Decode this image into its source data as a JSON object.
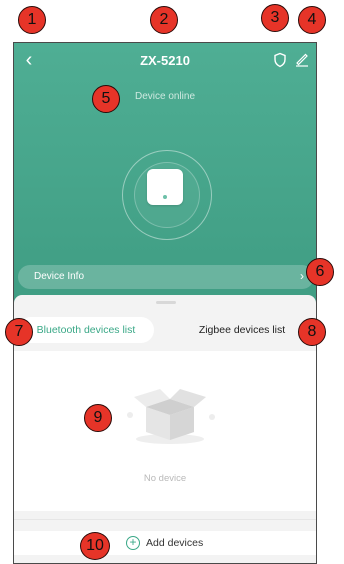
{
  "nav": {
    "title": "ZX-5210",
    "back_icon": "back-chevron-icon",
    "shield_icon": "shield-icon",
    "edit_icon": "pencil-icon"
  },
  "status": {
    "text": "Device online"
  },
  "device_info": {
    "label": "Device Info",
    "chevron": "›"
  },
  "tabs": [
    {
      "label": "Bluetooth devices list",
      "active": true
    },
    {
      "label": "Zigbee devices list",
      "active": false
    }
  ],
  "empty": {
    "text": "No device",
    "icon": "empty-box-icon"
  },
  "add": {
    "label": "Add devices",
    "icon": "plus-circle-icon"
  },
  "markers": [
    "1",
    "2",
    "3",
    "4",
    "5",
    "6",
    "7",
    "8",
    "9",
    "10"
  ],
  "colors": {
    "header_green": "#4fae94",
    "accent": "#3aa887",
    "marker_red": "#e63428"
  }
}
